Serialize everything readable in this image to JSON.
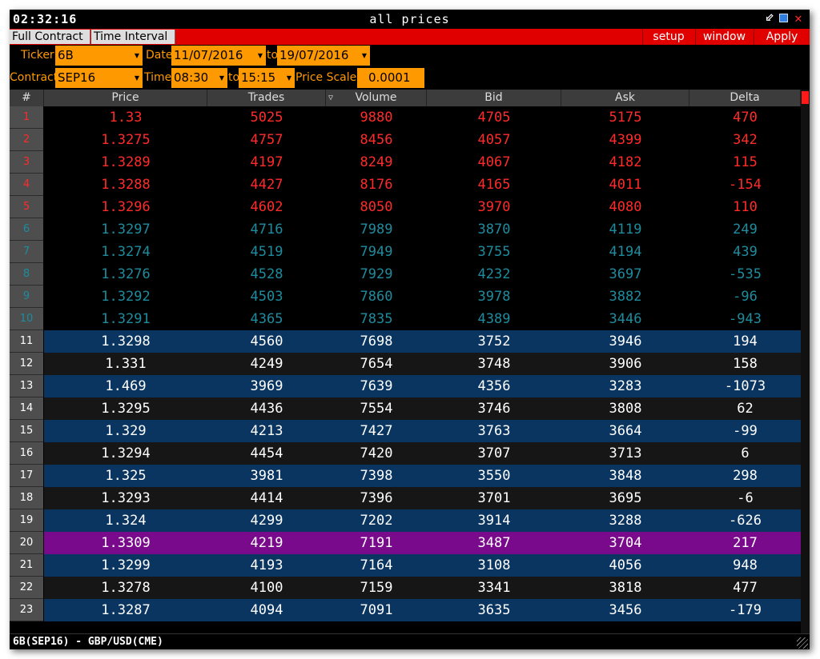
{
  "window": {
    "clock": "02:32:16",
    "title": "all prices",
    "min_glyph": "⬃",
    "close_glyph": "✕"
  },
  "tabs": [
    "Full Contract",
    "Time Interval"
  ],
  "menu": {
    "setup": "setup",
    "window": "window",
    "apply": "Apply"
  },
  "filters": {
    "ticker_label": "Ticker",
    "ticker": "6B",
    "date_label": "Date",
    "date_from": "11/07/2016",
    "date_to_label": "to",
    "date_to": "19/07/2016",
    "contract_label": "Contract",
    "contract": "SEP16",
    "time_label": "Time",
    "time_from": "08:30",
    "time_to_label": "to",
    "time_to": "15:15",
    "price_scale_label": "Price Scale",
    "price_scale": "0.0001"
  },
  "table": {
    "columns": [
      "#",
      "Price",
      "Trades",
      "Volume",
      "Bid",
      "Ask",
      "Delta"
    ],
    "sort_icon": "▽",
    "rows": [
      {
        "n": "1",
        "price": "1.33",
        "trades": "5025",
        "volume": "9880",
        "bid": "4705",
        "ask": "5175",
        "delta": "470"
      },
      {
        "n": "2",
        "price": "1.3275",
        "trades": "4757",
        "volume": "8456",
        "bid": "4057",
        "ask": "4399",
        "delta": "342"
      },
      {
        "n": "3",
        "price": "1.3289",
        "trades": "4197",
        "volume": "8249",
        "bid": "4067",
        "ask": "4182",
        "delta": "115"
      },
      {
        "n": "4",
        "price": "1.3288",
        "trades": "4427",
        "volume": "8176",
        "bid": "4165",
        "ask": "4011",
        "delta": "-154"
      },
      {
        "n": "5",
        "price": "1.3296",
        "trades": "4602",
        "volume": "8050",
        "bid": "3970",
        "ask": "4080",
        "delta": "110"
      },
      {
        "n": "6",
        "price": "1.3297",
        "trades": "4716",
        "volume": "7989",
        "bid": "3870",
        "ask": "4119",
        "delta": "249"
      },
      {
        "n": "7",
        "price": "1.3274",
        "trades": "4519",
        "volume": "7949",
        "bid": "3755",
        "ask": "4194",
        "delta": "439"
      },
      {
        "n": "8",
        "price": "1.3276",
        "trades": "4528",
        "volume": "7929",
        "bid": "4232",
        "ask": "3697",
        "delta": "-535"
      },
      {
        "n": "9",
        "price": "1.3292",
        "trades": "4503",
        "volume": "7860",
        "bid": "3978",
        "ask": "3882",
        "delta": "-96"
      },
      {
        "n": "10",
        "price": "1.3291",
        "trades": "4365",
        "volume": "7835",
        "bid": "4389",
        "ask": "3446",
        "delta": "-943"
      },
      {
        "n": "11",
        "price": "1.3298",
        "trades": "4560",
        "volume": "7698",
        "bid": "3752",
        "ask": "3946",
        "delta": "194"
      },
      {
        "n": "12",
        "price": "1.331",
        "trades": "4249",
        "volume": "7654",
        "bid": "3748",
        "ask": "3906",
        "delta": "158"
      },
      {
        "n": "13",
        "price": "1.469",
        "trades": "3969",
        "volume": "7639",
        "bid": "4356",
        "ask": "3283",
        "delta": "-1073"
      },
      {
        "n": "14",
        "price": "1.3295",
        "trades": "4436",
        "volume": "7554",
        "bid": "3746",
        "ask": "3808",
        "delta": "62"
      },
      {
        "n": "15",
        "price": "1.329",
        "trades": "4213",
        "volume": "7427",
        "bid": "3763",
        "ask": "3664",
        "delta": "-99"
      },
      {
        "n": "16",
        "price": "1.3294",
        "trades": "4454",
        "volume": "7420",
        "bid": "3707",
        "ask": "3713",
        "delta": "6"
      },
      {
        "n": "17",
        "price": "1.325",
        "trades": "3981",
        "volume": "7398",
        "bid": "3550",
        "ask": "3848",
        "delta": "298"
      },
      {
        "n": "18",
        "price": "1.3293",
        "trades": "4414",
        "volume": "7396",
        "bid": "3701",
        "ask": "3695",
        "delta": "-6"
      },
      {
        "n": "19",
        "price": "1.324",
        "trades": "4299",
        "volume": "7202",
        "bid": "3914",
        "ask": "3288",
        "delta": "-626"
      },
      {
        "n": "20",
        "price": "1.3309",
        "trades": "4219",
        "volume": "7191",
        "bid": "3487",
        "ask": "3704",
        "delta": "217"
      },
      {
        "n": "21",
        "price": "1.3299",
        "trades": "4193",
        "volume": "7164",
        "bid": "3108",
        "ask": "4056",
        "delta": "948"
      },
      {
        "n": "22",
        "price": "1.3278",
        "trades": "4100",
        "volume": "7159",
        "bid": "3341",
        "ask": "3818",
        "delta": "477"
      },
      {
        "n": "23",
        "price": "1.3287",
        "trades": "4094",
        "volume": "7091",
        "bid": "3635",
        "ask": "3456",
        "delta": "-179"
      }
    ]
  },
  "colors": {
    "top_red": "#ff2b2b",
    "top_teal": "#1e8c9e",
    "row_blue": "#0a3560",
    "row_black": "#161616",
    "row_highlight": "#7a0a8c",
    "text_white": "#ffffff",
    "accent_orange": "#ff9900"
  },
  "status": "6B(SEP16) - GBP/USD(CME)"
}
